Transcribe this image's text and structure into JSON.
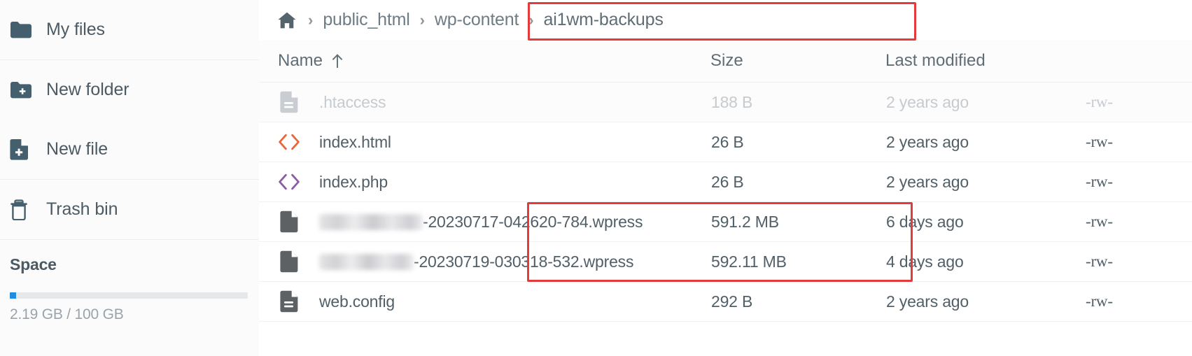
{
  "sidebar": {
    "items": [
      {
        "label": "My files",
        "icon": "folder-icon",
        "name": "my-files"
      },
      {
        "label": "New folder",
        "icon": "folder-plus-icon",
        "name": "new-folder"
      },
      {
        "label": "New file",
        "icon": "file-plus-icon",
        "name": "new-file"
      },
      {
        "label": "Trash bin",
        "icon": "trash-icon",
        "name": "trash-bin"
      }
    ],
    "space": {
      "title": "Space",
      "used_text": "2.19 GB / 100 GB",
      "percent": 2.19,
      "bar_color": "#1f8ce0"
    }
  },
  "breadcrumb": {
    "home_icon": "home-icon",
    "separator": "›",
    "items": [
      {
        "label": "public_html"
      },
      {
        "label": "wp-content"
      },
      {
        "label": "ai1wm-backups"
      }
    ]
  },
  "table": {
    "columns": {
      "name": "Name",
      "size": "Size",
      "modified": "Last modified",
      "perms": ""
    },
    "sort_icon": "arrow-up-icon",
    "sort_column": "Name",
    "sort_direction": "ascending",
    "rows": [
      {
        "icon": "file-lines-icon",
        "icon_color": "#c9ccd0",
        "name": ".htaccess",
        "name_redacted": false,
        "size": "188 B",
        "modified": "2 years ago",
        "perms": "-rw-",
        "dimmed": true
      },
      {
        "icon": "code-brackets-icon",
        "icon_color": "#e8663a",
        "name": "index.html",
        "name_redacted": false,
        "size": "26 B",
        "modified": "2 years ago",
        "perms": "-rw-",
        "dimmed": false
      },
      {
        "icon": "code-brackets-icon",
        "icon_color": "#8e5ba6",
        "name": "index.php",
        "name_redacted": false,
        "size": "26 B",
        "modified": "2 years ago",
        "perms": "-rw-",
        "dimmed": false
      },
      {
        "icon": "file-blank-icon",
        "icon_color": "#5e6164",
        "name": "-20230717-042620-784.wpress",
        "name_redacted": true,
        "redacted_width": 148,
        "size": "591.2 MB",
        "modified": "6 days ago",
        "perms": "-rw-",
        "dimmed": false
      },
      {
        "icon": "file-blank-icon",
        "icon_color": "#5e6164",
        "name": "-20230719-030318-532.wpress",
        "name_redacted": true,
        "redacted_width": 135,
        "size": "592.11 MB",
        "modified": "4 days ago",
        "perms": "-rw-",
        "dimmed": false
      },
      {
        "icon": "file-lines-icon",
        "icon_color": "#5e6164",
        "name": "web.config",
        "name_redacted": false,
        "size": "292 B",
        "modified": "2 years ago",
        "perms": "-rw-",
        "dimmed": false
      }
    ]
  },
  "annotations": {
    "highlight_color": "#e33b3b",
    "boxes": [
      {
        "name": "breadcrumb-highlight",
        "target": "breadcrumb path ai1wm-backups"
      },
      {
        "name": "backup-files-highlight",
        "target": "two .wpress backup rows"
      }
    ]
  }
}
